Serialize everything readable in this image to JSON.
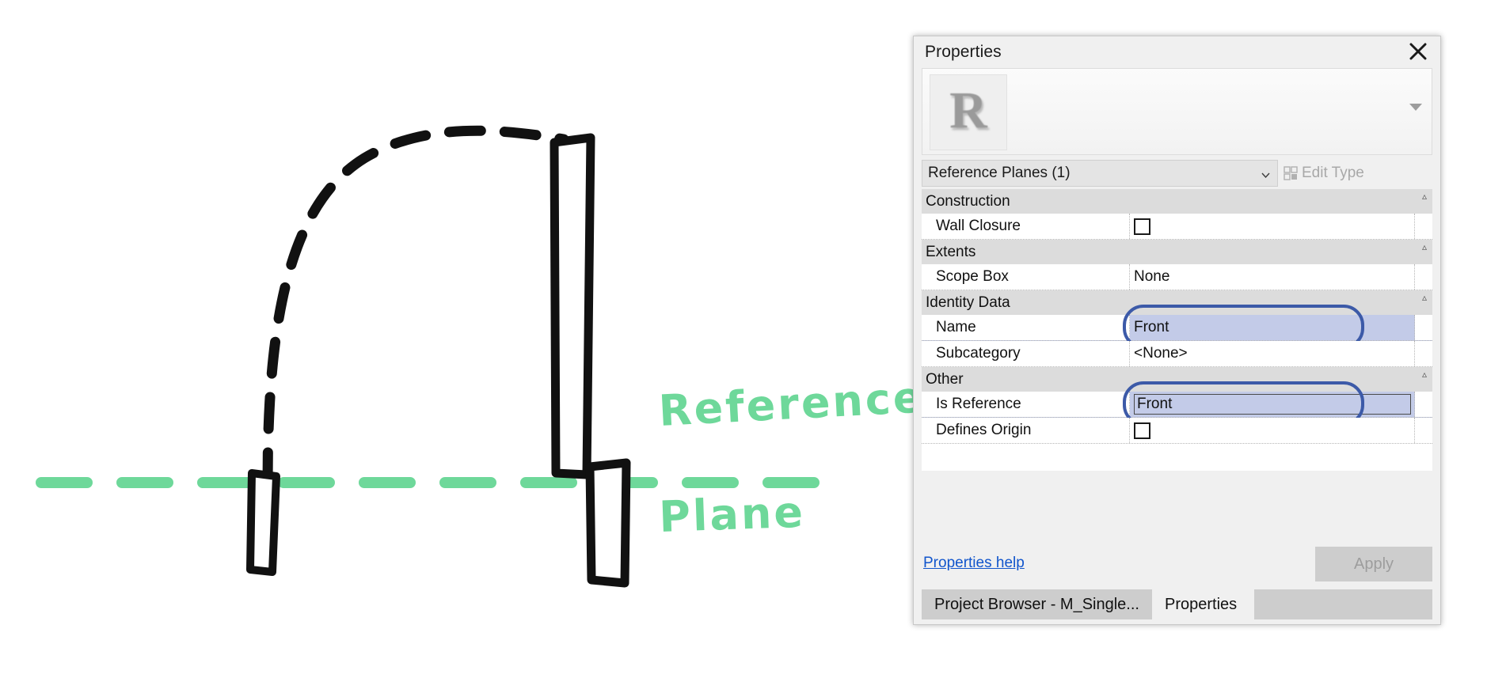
{
  "sketch": {
    "annotation_line1": "Reference",
    "annotation_line2": "Plane",
    "annotation_color": "#6ed89a",
    "reference_plane_color": "#6ed89a",
    "ink_color": "#000000",
    "elements": [
      "door-swing-arc-dashed",
      "door-panel",
      "left-wall-jamb",
      "right-wall-jamb",
      "reference-plane-dashed-line"
    ]
  },
  "panel": {
    "title": "Properties",
    "close_icon": "close-icon",
    "type_preview": {
      "thumbnail_glyph": "R",
      "expand_icon": "chevron-down-icon"
    },
    "type_selector": {
      "value": "Reference Planes (1)",
      "caret_icon": "chevron-down-icon"
    },
    "edit_type": {
      "label": "Edit Type",
      "icon": "edit-type-icon",
      "enabled": false
    },
    "groups": [
      {
        "name": "Construction",
        "collapse_icon": "collapse-icon",
        "rows": [
          {
            "name": "Wall Closure",
            "value": "",
            "control": "checkbox",
            "checked": false,
            "highlighted": false
          }
        ]
      },
      {
        "name": "Extents",
        "collapse_icon": "collapse-icon",
        "rows": [
          {
            "name": "Scope Box",
            "value": "None",
            "control": "text",
            "highlighted": false
          }
        ]
      },
      {
        "name": "Identity Data",
        "collapse_icon": "collapse-icon",
        "rows": [
          {
            "name": "Name",
            "value": "Front",
            "control": "text",
            "highlighted": true
          },
          {
            "name": "Subcategory",
            "value": "<None>",
            "control": "text",
            "highlighted": false
          }
        ]
      },
      {
        "name": "Other",
        "collapse_icon": "collapse-icon",
        "rows": [
          {
            "name": "Is Reference",
            "value": "Front",
            "control": "combo",
            "highlighted": true
          },
          {
            "name": "Defines Origin",
            "value": "",
            "control": "checkbox",
            "checked": false,
            "highlighted": false
          }
        ]
      }
    ],
    "footer": {
      "help_link": "Properties help",
      "apply_button": "Apply",
      "apply_enabled": false
    },
    "tabs": [
      {
        "label": "Project Browser - M_Single...",
        "active": false
      },
      {
        "label": "Properties",
        "active": true
      }
    ]
  },
  "colors": {
    "highlight_border": "#3c5aa8",
    "highlight_fill": "#c3cbe8",
    "link": "#1155cc",
    "green_ink": "#6ed89a"
  }
}
